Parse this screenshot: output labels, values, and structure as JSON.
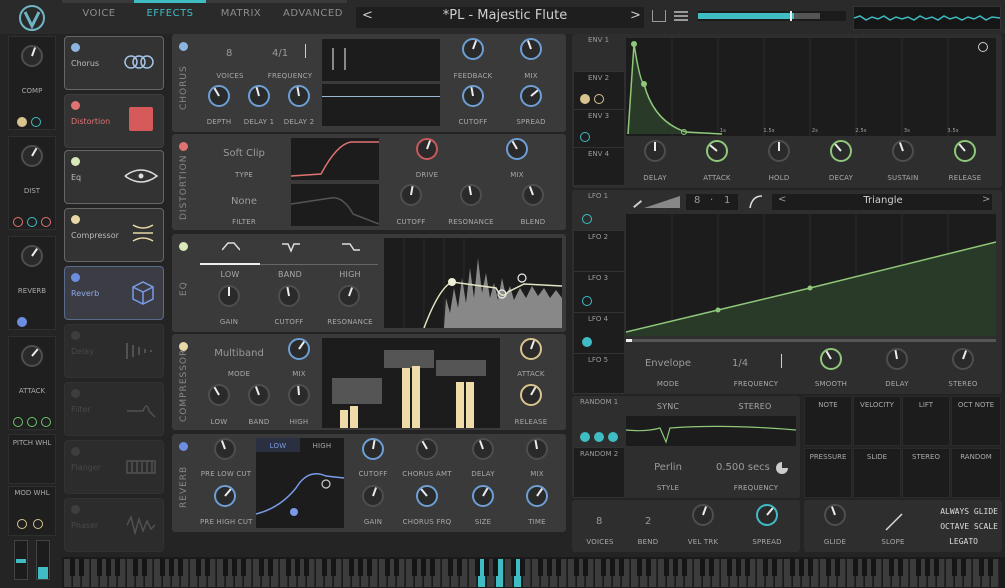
{
  "nav": {
    "tabs": [
      "VOICE",
      "EFFECTS",
      "MATRIX",
      "ADVANCED"
    ],
    "active": "EFFECTS"
  },
  "preset": {
    "name": "*PL - Majestic Flute",
    "prev": "<",
    "next": ">"
  },
  "colors": {
    "accent": "#3fbcc4",
    "chorus": "#8cb4e0",
    "distortion": "#e27272",
    "eq": "#d8e8b8",
    "compressor": "#e8d8a8",
    "reverb": "#6d8ee0",
    "lfo": "#8fc87a"
  },
  "modules": [
    {
      "name": "Chorus",
      "icon": "chorus-rings-icon"
    },
    {
      "name": "Distortion",
      "icon": "distortion-icon"
    },
    {
      "name": "Eq",
      "icon": "eq-eye-icon"
    },
    {
      "name": "Compressor",
      "icon": "compressor-icon"
    },
    {
      "name": "Reverb",
      "icon": "reverb-cube-icon"
    },
    {
      "name": "Delay",
      "icon": "delay-icon"
    },
    {
      "name": "Filter",
      "icon": "filter-icon"
    },
    {
      "name": "Flanger",
      "icon": "flanger-icon"
    },
    {
      "name": "Phaser",
      "icon": "phaser-icon"
    }
  ],
  "macros": [
    "COMP",
    "DIST",
    "REVERB",
    "ATTACK"
  ],
  "wheels": [
    "PITCH WHL",
    "MOD WHL"
  ],
  "chorus": {
    "title": "CHORUS",
    "voices_val": "8",
    "voices": "VOICES",
    "freq_val": "4/1",
    "freq": "FREQUENCY",
    "feedback": "FEEDBACK",
    "mix": "MIX",
    "depth": "DEPTH",
    "delay1": "DELAY 1",
    "delay2": "DELAY 2",
    "cutoff": "CUTOFF",
    "spread": "SPREAD"
  },
  "distortion": {
    "title": "DISTORTION",
    "type_val": "Soft Clip",
    "type": "TYPE",
    "filter_val": "None",
    "filter": "FILTER",
    "drive": "DRIVE",
    "mix": "MIX",
    "cutoff": "CUTOFF",
    "resonance": "RESONANCE",
    "blend": "BLEND"
  },
  "eq": {
    "title": "EQ",
    "low": "LOW",
    "band": "BAND",
    "high": "HIGH",
    "gain": "GAIN",
    "cutoff": "CUTOFF",
    "resonance": "RESONANCE"
  },
  "compressor": {
    "title": "COMPRESSOR",
    "mode_val": "Multiband",
    "mode": "MODE",
    "mix": "MIX",
    "low": "LOW",
    "band": "BAND",
    "high": "HIGH",
    "attack": "ATTACK",
    "release": "RELEASE"
  },
  "reverb": {
    "title": "REVERB",
    "pre_low": "PRE LOW CUT",
    "pre_high": "PRE HIGH CUT",
    "low_tab": "LOW",
    "high_tab": "HIGH",
    "cutoff": "CUTOFF",
    "chorus_amt": "CHORUS AMT",
    "delay": "DELAY",
    "mix": "MIX",
    "gain": "GAIN",
    "chorus_frq": "CHORUS FRQ",
    "size": "SIZE",
    "time": "TIME"
  },
  "env": {
    "tabs": [
      "ENV 1",
      "ENV 2",
      "ENV 3",
      "ENV 4"
    ],
    "time_marks": [
      "1s",
      "1.5s",
      "2s",
      "2.5s",
      "3s",
      "3.5s"
    ],
    "knobs": [
      "DELAY",
      "ATTACK",
      "HOLD",
      "DECAY",
      "SUSTAIN",
      "RELEASE"
    ]
  },
  "lfo": {
    "tabs": [
      "LFO 1",
      "LFO 2",
      "LFO 3",
      "LFO 4",
      "LFO 5"
    ],
    "grid_a": "8",
    "grid_sep": "·",
    "grid_b": "1",
    "shape": "Triangle",
    "mode_val": "Envelope",
    "mode": "MODE",
    "freq_val": "1/4",
    "freq": "FREQUENCY",
    "smooth": "SMOOTH",
    "delay": "DELAY",
    "stereo": "STEREO"
  },
  "random": {
    "tabs": [
      "RANDOM 1",
      "RANDOM 2"
    ],
    "sync": "SYNC",
    "stereo": "STEREO",
    "style_val": "Perlin",
    "style": "STYLE",
    "freq_val": "0.500 secs",
    "freq": "FREQUENCY"
  },
  "mod_sources": [
    "NOTE",
    "VELOCITY",
    "LIFT",
    "OCT NOTE",
    "PRESSURE",
    "SLIDE",
    "STEREO",
    "RANDOM"
  ],
  "voice": {
    "voices_val": "8",
    "voices": "VOICES",
    "bend_val": "2",
    "bend": "BEND",
    "vel_trk": "VEL TRK",
    "spread": "SPREAD",
    "glide": "GLIDE",
    "slope": "SLOPE",
    "always_glide": "ALWAYS GLIDE",
    "octave_scale": "OCTAVE SCALE",
    "legato": "LEGATO"
  }
}
